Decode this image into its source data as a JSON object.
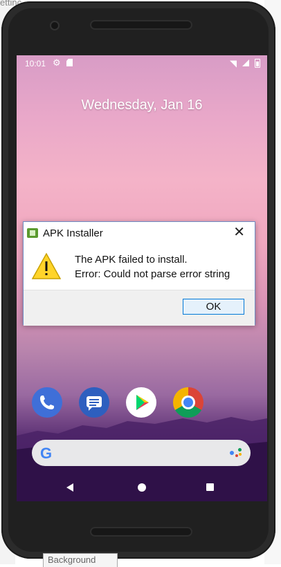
{
  "background": {
    "top_fragment": "ettinc",
    "bottom_tab": "Background"
  },
  "status_bar": {
    "time": "10:01",
    "icons": [
      "settings-gear-icon",
      "sd-card-icon",
      "wifi-icon",
      "cell-signal-icon",
      "battery-icon"
    ]
  },
  "lockscreen": {
    "date": "Wednesday, Jan 16"
  },
  "dialog": {
    "title": "APK Installer",
    "close_label": "✕",
    "message_line1": "The APK failed to install.",
    "message_line2": "Error: Could not parse error string",
    "ok_label": "OK"
  },
  "dock": {
    "apps": [
      "Phone",
      "Messages",
      "Play Store",
      "Chrome"
    ]
  },
  "search": {
    "logo": "G"
  },
  "colors": {
    "dialog_border": "#6e8cc4",
    "ok_button_border": "#0078d7",
    "ok_button_bg": "#e5f1fb"
  }
}
